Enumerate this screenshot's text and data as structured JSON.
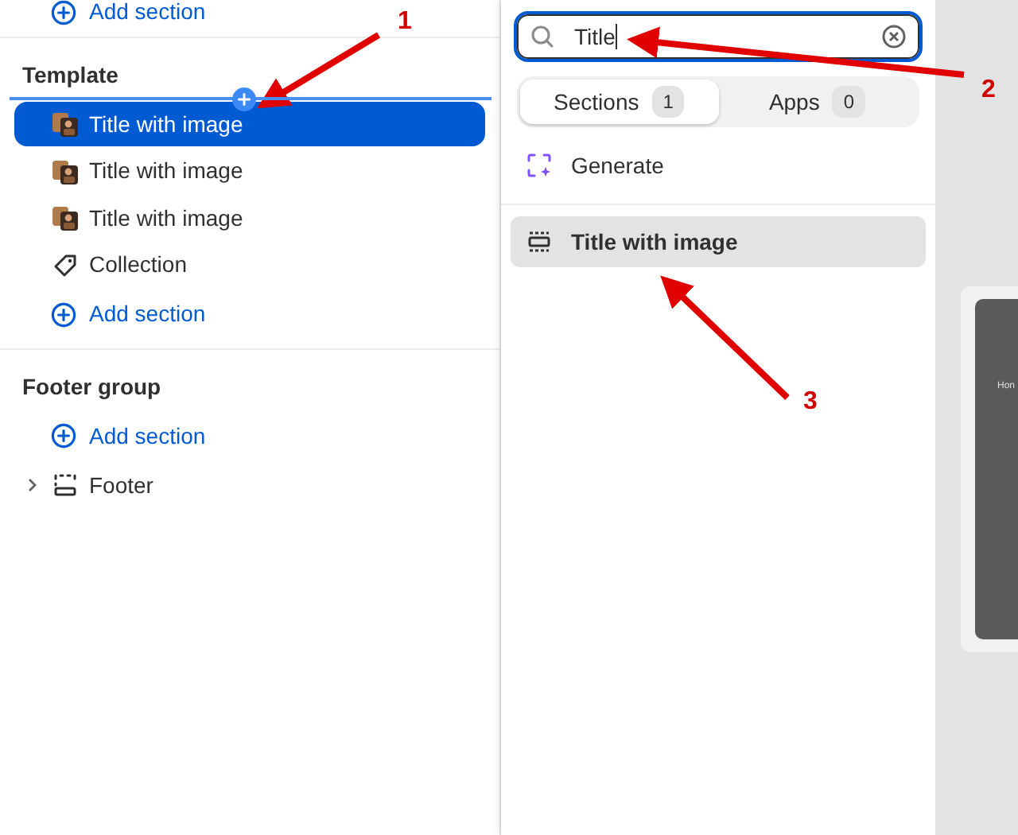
{
  "sidebar": {
    "top_add_label": "Add section",
    "groups": [
      {
        "title": "Template",
        "items": [
          {
            "kind": "image",
            "label": "Title with image",
            "selected": true,
            "drop_indicator": true
          },
          {
            "kind": "image",
            "label": "Title with image",
            "selected": false,
            "drop_indicator": false
          },
          {
            "kind": "image",
            "label": "Title with image",
            "selected": false,
            "drop_indicator": false
          },
          {
            "kind": "collection",
            "label": "Collection",
            "selected": false,
            "drop_indicator": false
          },
          {
            "kind": "add",
            "label": "Add section"
          }
        ]
      },
      {
        "title": "Footer group",
        "items": [
          {
            "kind": "add",
            "label": "Add section"
          },
          {
            "kind": "footer",
            "label": "Footer",
            "selected": false,
            "drop_indicator": false
          }
        ]
      }
    ]
  },
  "picker": {
    "search": {
      "value": "Title"
    },
    "tabs": [
      {
        "label": "Sections",
        "count": "1",
        "selected": true
      },
      {
        "label": "Apps",
        "count": "0",
        "selected": false
      }
    ],
    "generate_label": "Generate",
    "results": [
      {
        "label": "Title with image",
        "selected": true
      }
    ]
  },
  "preview": {
    "text": "Hon"
  },
  "annotations": [
    {
      "label": "1"
    },
    {
      "label": "2"
    },
    {
      "label": "3"
    }
  ]
}
